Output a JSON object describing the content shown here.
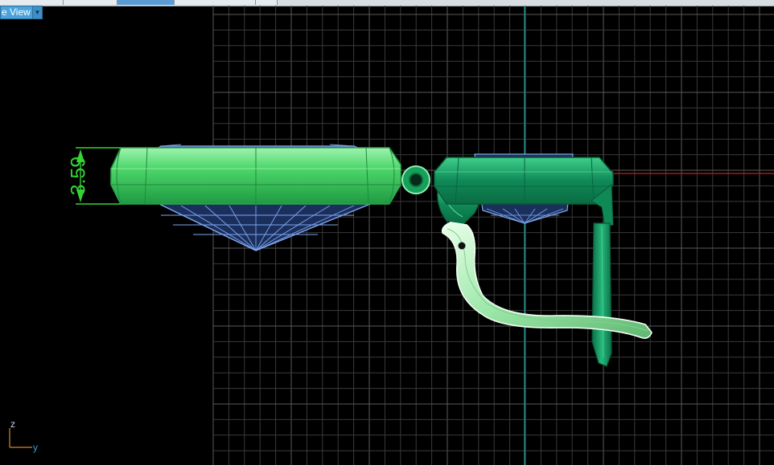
{
  "toolbar": {
    "view_label": "e View",
    "dropdown_icon": "chevron-down-icon"
  },
  "dimension": {
    "value": "3.59"
  },
  "axes": {
    "z_label": "z",
    "y_label": "y"
  },
  "colors": {
    "background": "#000000",
    "grid": "#3a3a3a",
    "grid_major": "#5a5a5a",
    "axis_vertical": "#1e8c8c",
    "axis_horizontal": "#a01c1c",
    "dimension": "#35d335",
    "gem": "#7fa6ef",
    "setting_left": "#3ed368",
    "setting_right": "#18a66b",
    "hook": "#c9f7c9"
  }
}
